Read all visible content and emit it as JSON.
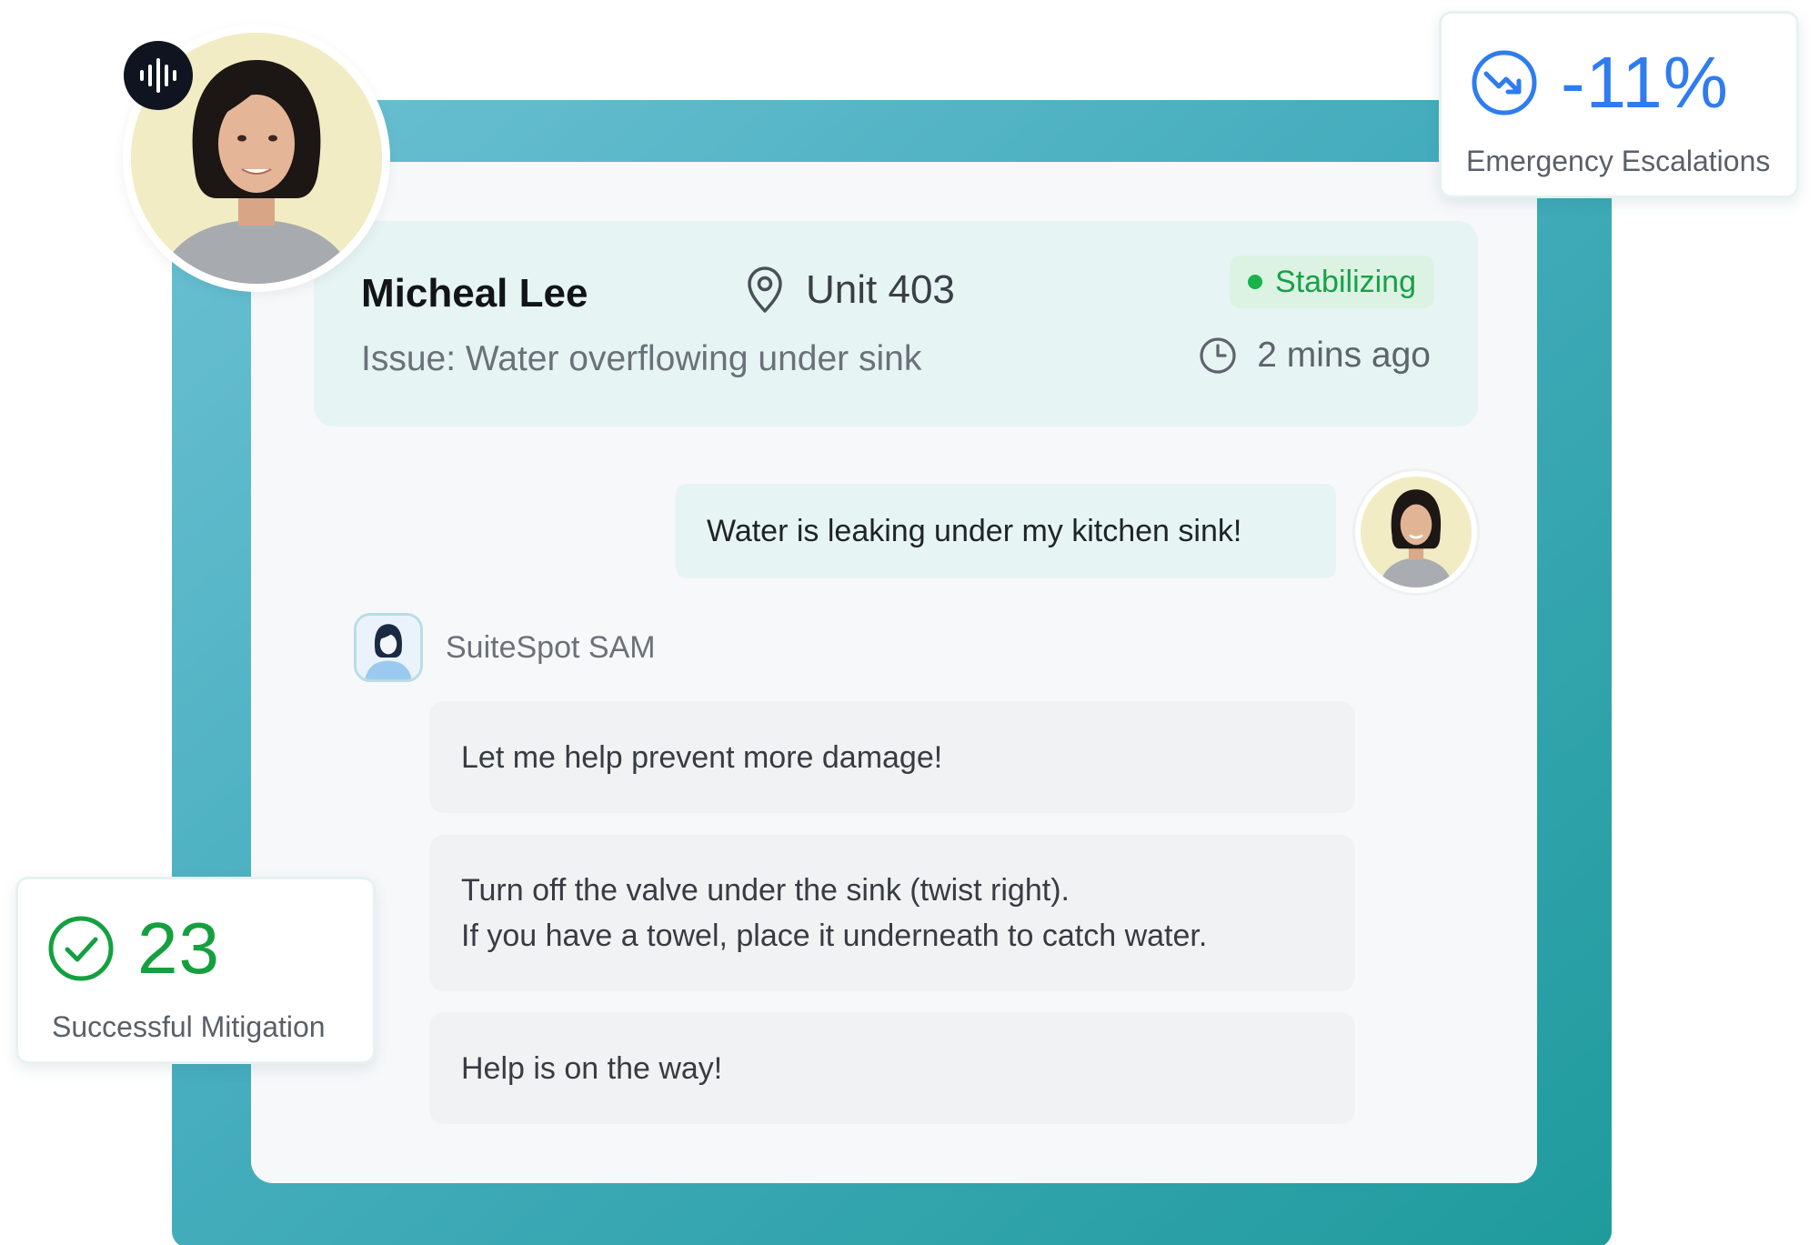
{
  "ticket": {
    "customer_name": "Micheal Lee",
    "unit": "Unit 403",
    "issue": "Issue: Water overflowing under sink",
    "status": "Stabilizing",
    "time_ago": "2 mins ago"
  },
  "conversation": {
    "user_message": "Water is leaking under my kitchen sink!",
    "agent_name": "SuiteSpot SAM",
    "agent_messages": [
      "Let me help prevent more damage!",
      "Turn off the valve under the sink (twist right).",
      "If you have a towel, place it underneath to catch water.",
      "Help is on the way!"
    ]
  },
  "stats": {
    "escalations": {
      "value": "-11%",
      "label": "Emergency Escalations"
    },
    "mitigation": {
      "value": "23",
      "label": "Successful Mitigation"
    }
  },
  "icons": {
    "voice": "audio-waveform-icon",
    "location": "map-pin-icon",
    "time": "clock-icon",
    "trend": "trending-down-icon",
    "check": "check-circle-icon"
  },
  "colors": {
    "teal_frame_start": "#6cc1d3",
    "teal_frame_end": "#1f9b9c",
    "status_green": "#18a048",
    "stat_blue": "#2f7cf0",
    "stat_green": "#15a040"
  }
}
